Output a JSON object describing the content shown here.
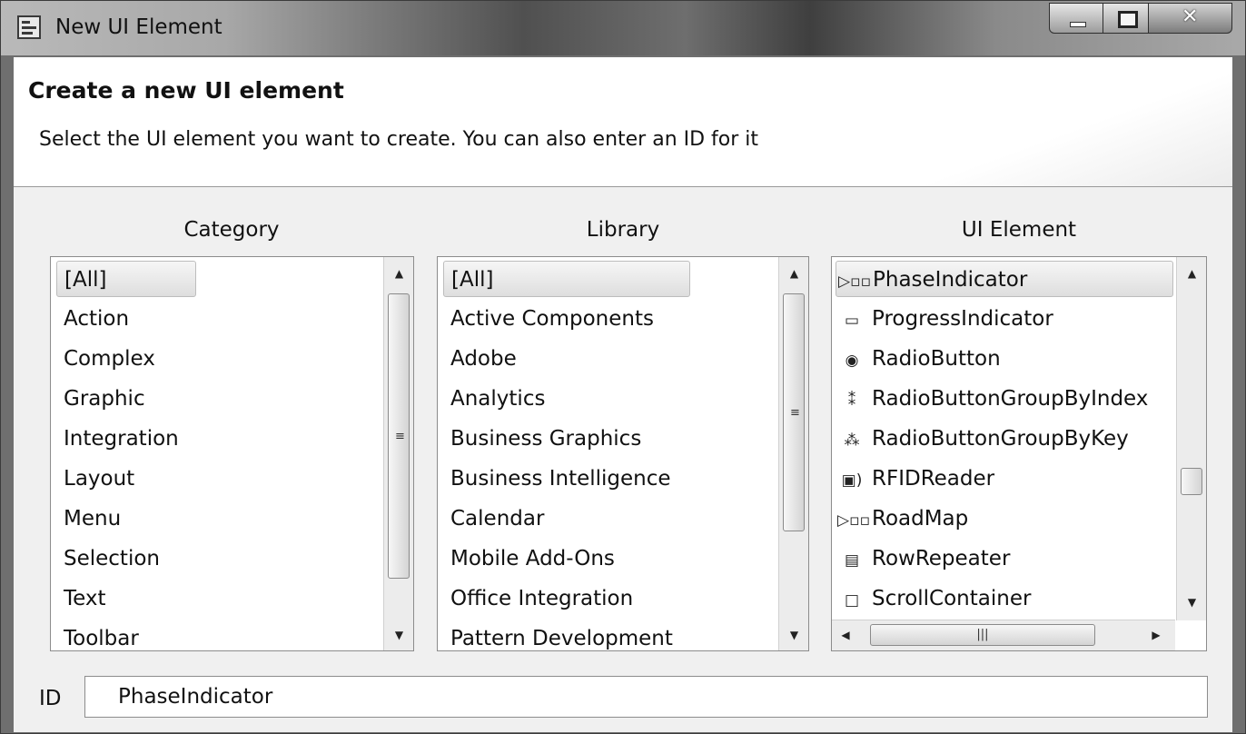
{
  "window": {
    "title": "New UI Element"
  },
  "header": {
    "title": "Create a new UI element",
    "description": "Select the UI element you want to create. You can also enter an ID for it"
  },
  "category": {
    "label": "Category",
    "items": [
      "[All]",
      "Action",
      "Complex",
      "Graphic",
      "Integration",
      "Layout",
      "Menu",
      "Selection",
      "Text",
      "Toolbar"
    ],
    "selected": "[All]"
  },
  "library": {
    "label": "Library",
    "items": [
      "[All]",
      "Active Components",
      "Adobe",
      "Analytics",
      "Business Graphics",
      "Business Intelligence",
      "Calendar",
      "Mobile Add-Ons",
      "Office Integration",
      "Pattern Development"
    ],
    "selected": "[All]"
  },
  "ui_element": {
    "label": "UI Element",
    "items": [
      {
        "label": "PhaseIndicator",
        "icon": "phase-indicator-icon"
      },
      {
        "label": "ProgressIndicator",
        "icon": "progress-indicator-icon"
      },
      {
        "label": "RadioButton",
        "icon": "radio-button-icon"
      },
      {
        "label": "RadioButtonGroupByIndex",
        "icon": "radio-group-index-icon"
      },
      {
        "label": "RadioButtonGroupByKey",
        "icon": "radio-group-key-icon"
      },
      {
        "label": "RFIDReader",
        "icon": "rfid-reader-icon"
      },
      {
        "label": "RoadMap",
        "icon": "roadmap-icon"
      },
      {
        "label": "RowRepeater",
        "icon": "row-repeater-icon"
      },
      {
        "label": "ScrollContainer",
        "icon": "scroll-container-icon"
      }
    ],
    "selected": "PhaseIndicator"
  },
  "id_field": {
    "label": "ID",
    "value": "PhaseIndicator"
  }
}
